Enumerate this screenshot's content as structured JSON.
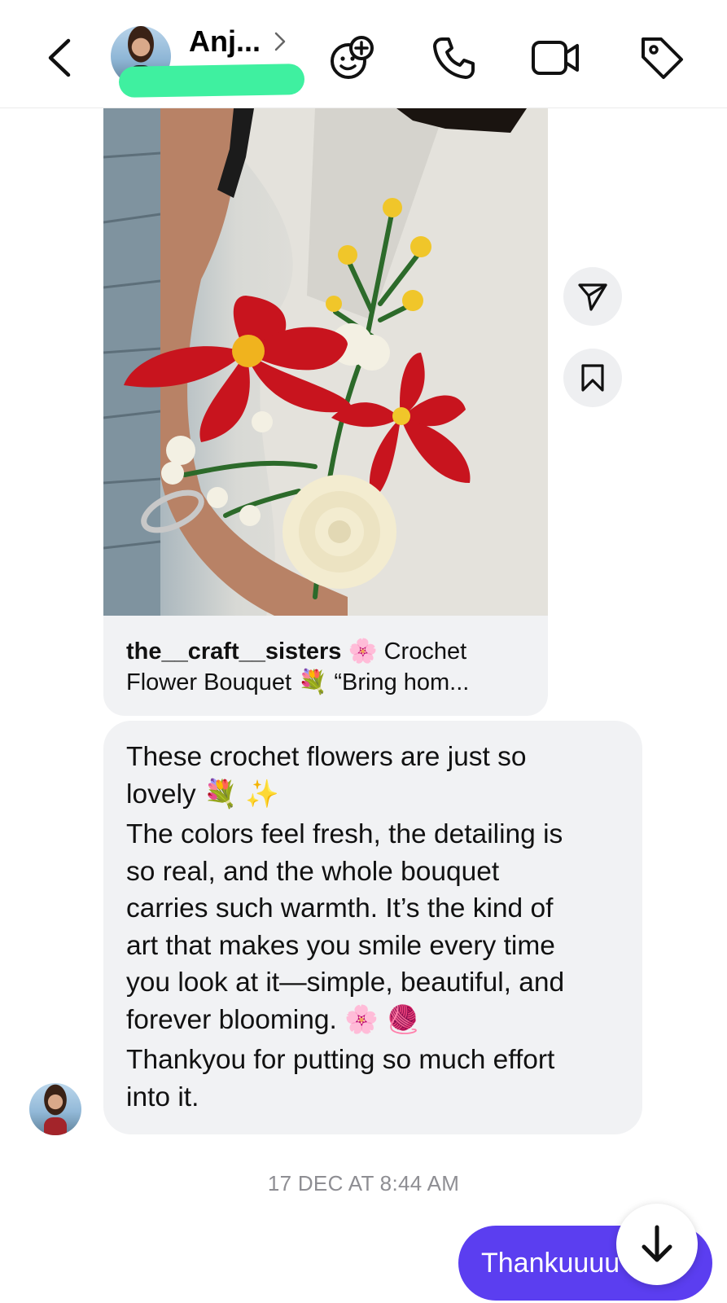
{
  "header": {
    "contact_name": "Anj...",
    "icons": {
      "back": "chevron-left-icon",
      "profile_chevron": "chevron-right-icon",
      "effects": "sticker-smiley-plus-icon",
      "call": "phone-icon",
      "video": "video-camera-icon",
      "tag": "tag-icon"
    }
  },
  "shared_post": {
    "username": "the__craft__sisters",
    "caption_line1_rest": " 🌸 Crochet",
    "caption_line2": "Flower Bouquet 💐 “Bring hom..."
  },
  "side_actions": {
    "share": "send-icon",
    "save": "bookmark-icon"
  },
  "received_message": {
    "lines": [
      "These crochet flowers are just so",
      "lovely 💐 ✨",
      "The colors feel fresh, the detailing is",
      "so real, and the whole bouquet",
      "carries such warmth. It’s the kind of",
      "art that makes you smile every time",
      "you look at it—simple, beautiful, and",
      "forever blooming. 🌸 🧶",
      "Thankyou for putting so much effort",
      "into it."
    ]
  },
  "timestamp": "17 DEC AT 8:44 AM",
  "sent_message": {
    "text": "Thankuuuu"
  },
  "colors": {
    "sent_bubble": "#5b3ef0",
    "received_bubble": "#f1f2f4",
    "username_redaction": "#3ff0a0"
  }
}
